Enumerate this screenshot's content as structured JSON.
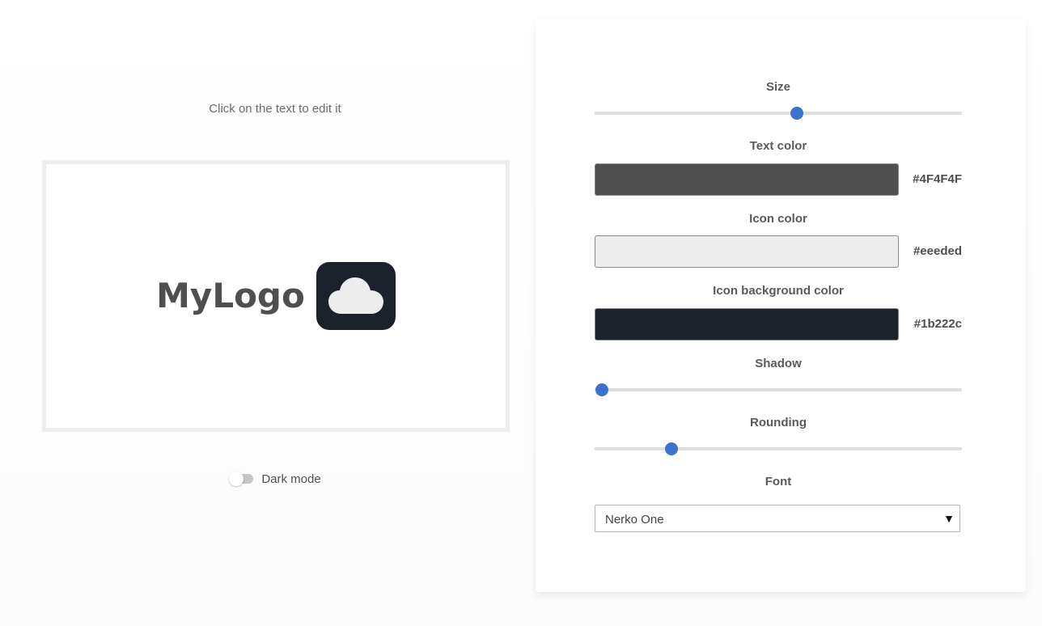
{
  "editor": {
    "hint": "Click on the text to edit it",
    "logo_text": "MyLogo",
    "dark_mode_label": "Dark mode",
    "dark_mode_on": false,
    "icon": "cloud-icon"
  },
  "controls": {
    "size": {
      "label": "Size",
      "value": 0.55
    },
    "text_color": {
      "label": "Text color",
      "hex": "#4F4F4F",
      "color": "#4f4f4f"
    },
    "icon_color": {
      "label": "Icon color",
      "hex": "#eeeded",
      "color": "#eeeded"
    },
    "icon_bg_color": {
      "label": "Icon background color",
      "hex": "#1b222c",
      "color": "#1b222c"
    },
    "shadow": {
      "label": "Shadow",
      "value": 0.02
    },
    "rounding": {
      "label": "Rounding",
      "value": 0.21
    },
    "font": {
      "label": "Font",
      "selected": "Nerko One"
    }
  },
  "colors": {
    "accent": "#3b72cc"
  }
}
